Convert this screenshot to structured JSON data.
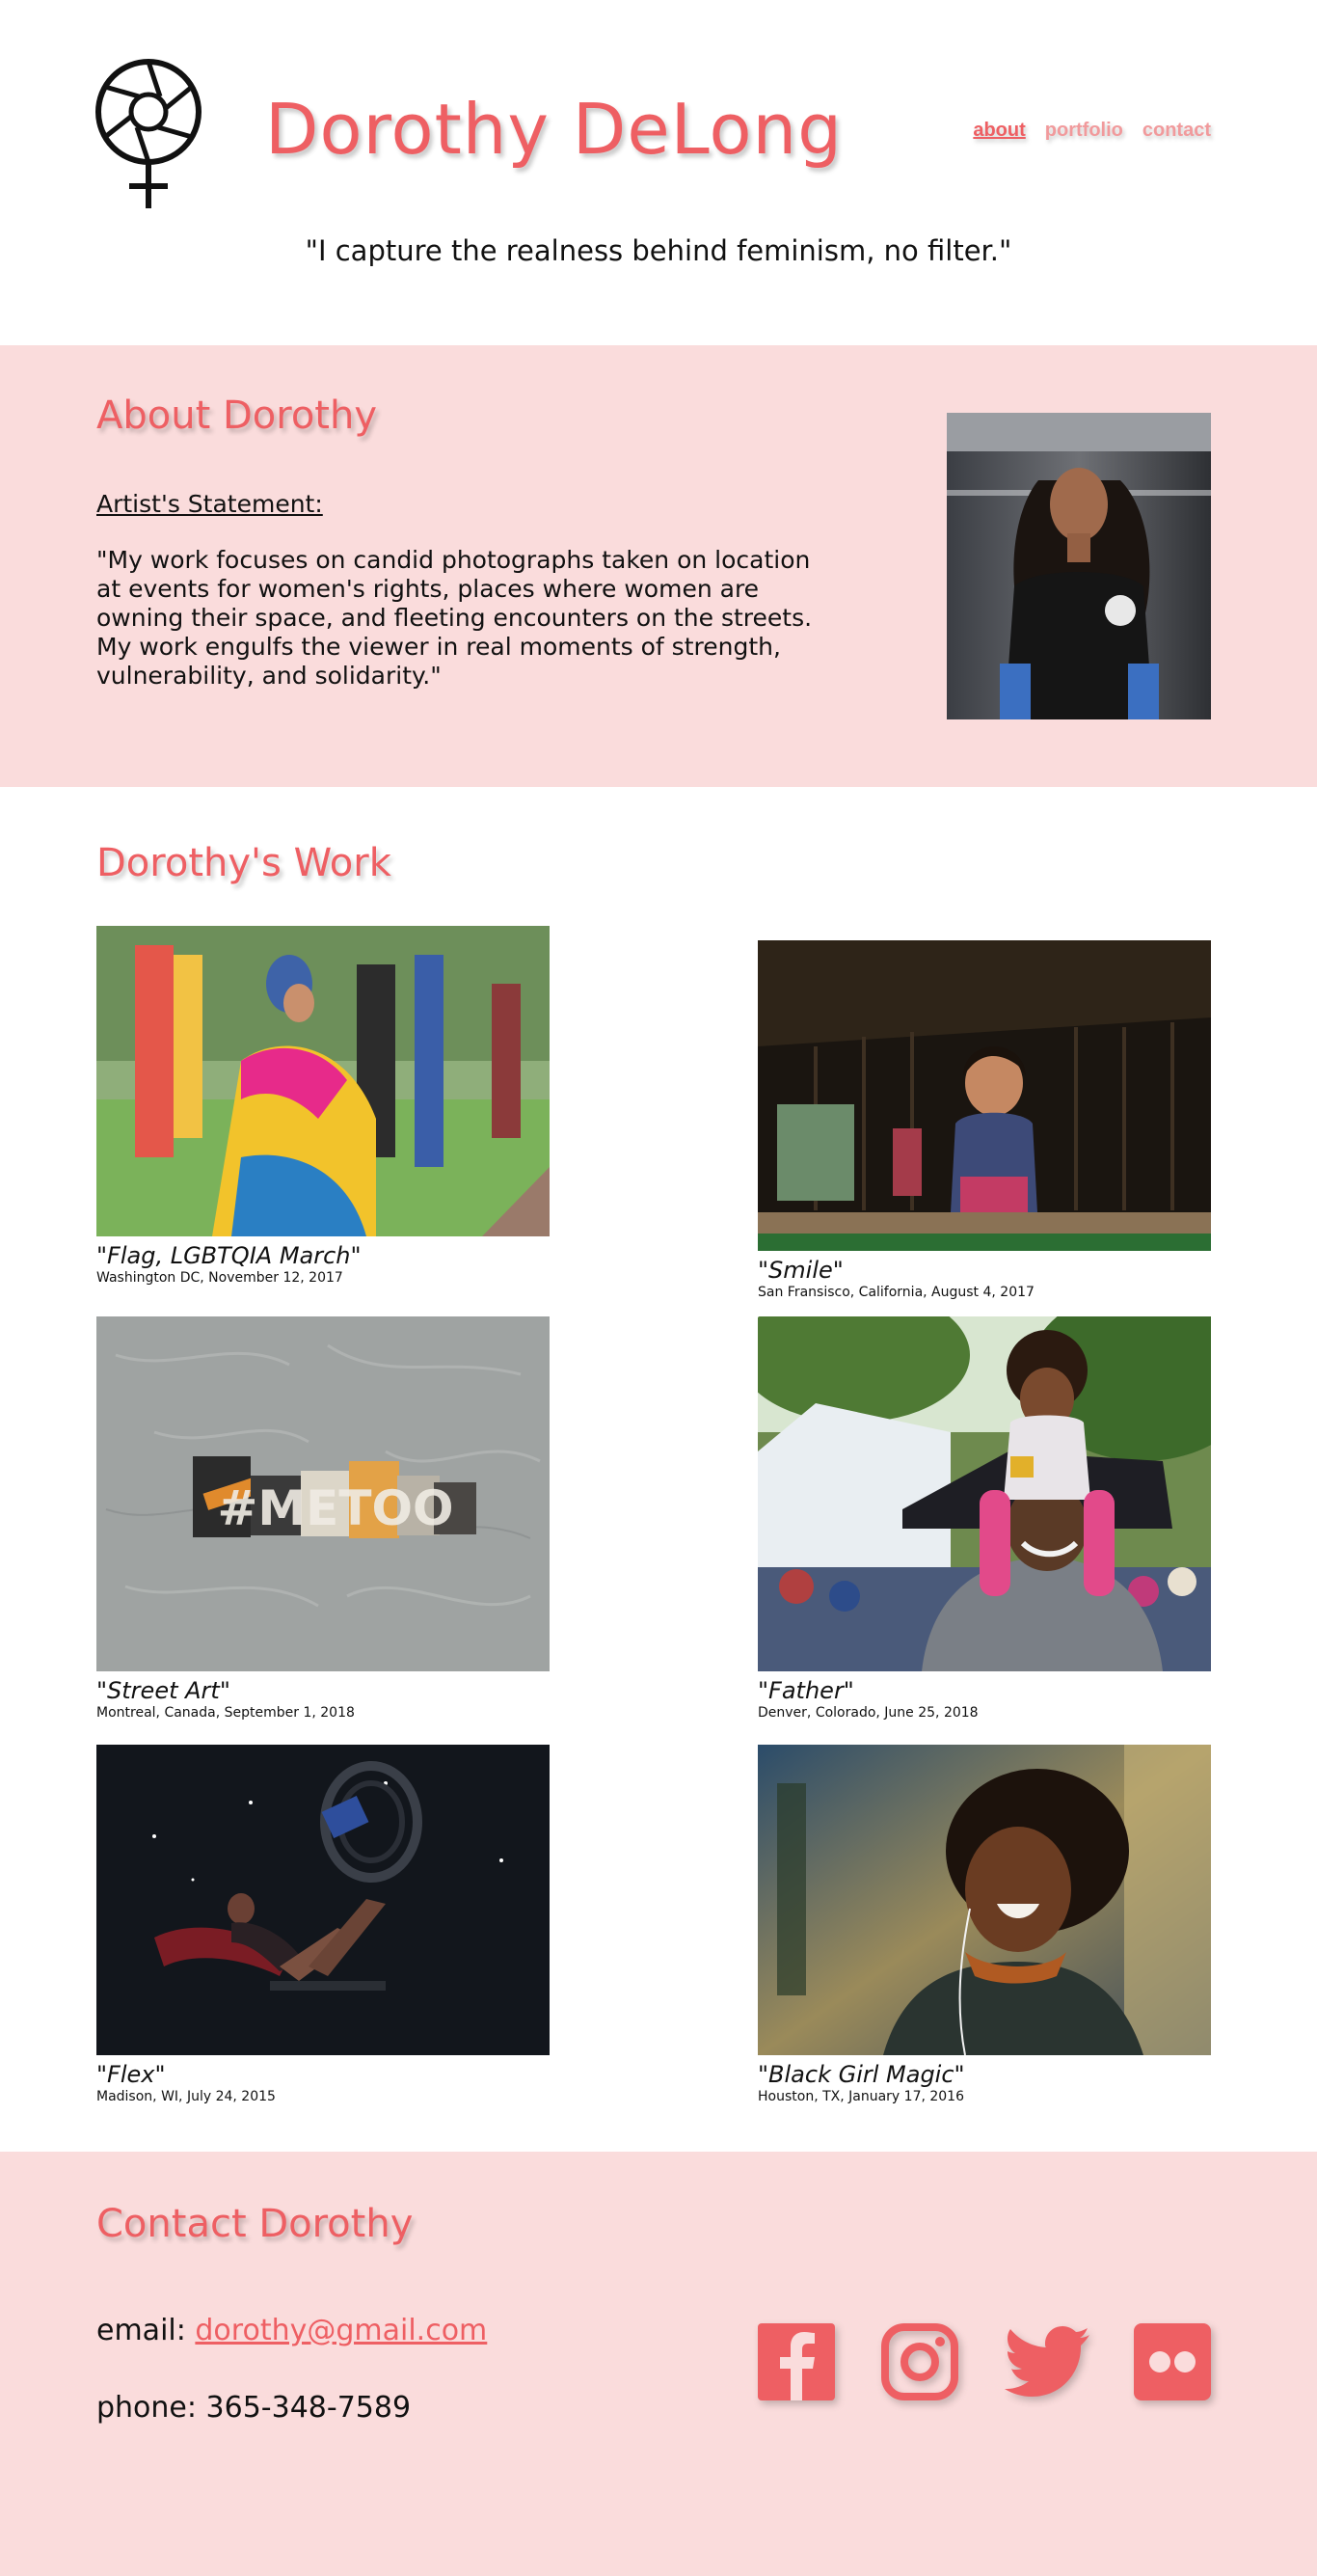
{
  "header": {
    "title": "Dorothy DeLong",
    "tagline": "\"I capture the realness behind feminism, no filter.\"",
    "nav": [
      "about",
      "portfolio",
      "contact"
    ]
  },
  "about": {
    "heading": "About Dorothy",
    "statement_label": "Artist's Statement:",
    "statement": "\"My work focuses on candid photographs taken on location at events for women's rights, places where women are owning their space, and fleeting encounters on the streets. My work engulfs the viewer in real moments of strength, vulnerability, and solidarity.\""
  },
  "work": {
    "heading": "Dorothy's Work",
    "items": [
      {
        "title": "\"Flag, LGBTQIA March\"",
        "meta": "Washington DC, November 12, 2017"
      },
      {
        "title": "\"Smile\"",
        "meta": "San Fransisco, California, August 4, 2017"
      },
      {
        "title": "\"Street Art\"",
        "meta": "Montreal, Canada, September 1, 2018",
        "art_text": "#METOO"
      },
      {
        "title": "\"Father\"",
        "meta": "Denver, Colorado, June 25, 2018"
      },
      {
        "title": "\"Flex\"",
        "meta": "Madison, WI, July 24, 2015"
      },
      {
        "title": "\"Black Girl Magic\"",
        "meta": "Houston, TX, January 17, 2016"
      }
    ]
  },
  "contact": {
    "heading": "Contact Dorothy",
    "email_label": "email:",
    "email": "dorothy@gmail.com",
    "phone_label": "phone:",
    "phone": "365-348-7589",
    "social_icons": [
      "facebook-icon",
      "instagram-icon",
      "twitter-icon",
      "flickr-icon"
    ]
  },
  "colors": {
    "accent": "#ee5f63",
    "accent_light": "#f19a9c",
    "section_bg": "#fadcdc"
  }
}
